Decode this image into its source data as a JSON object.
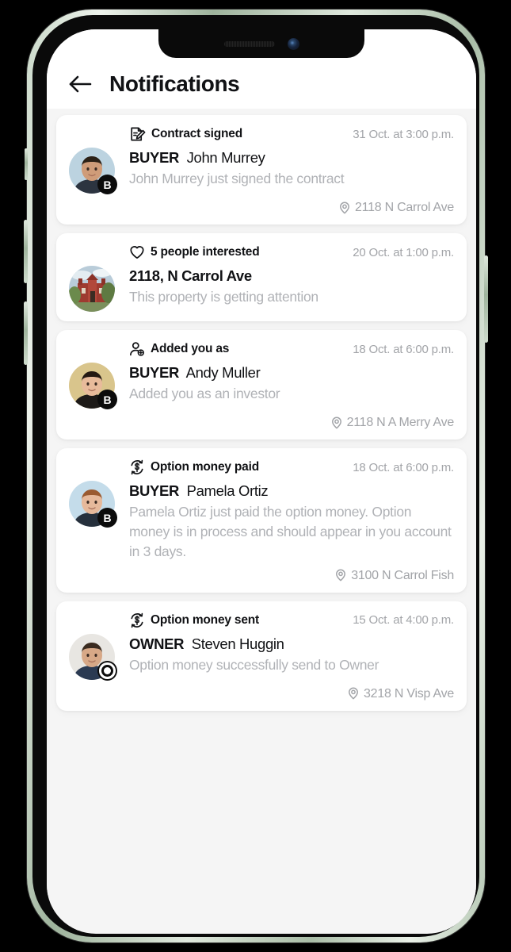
{
  "header": {
    "title": "Notifications",
    "back_icon": "arrow-left-icon"
  },
  "device": {
    "notch_speaker": "speaker-grille",
    "notch_camera": "front-camera"
  },
  "notifications": [
    {
      "type_icon": "contract-signed-icon",
      "type_label": "Contract signed",
      "time": "31 Oct. at 3:00 p.m.",
      "avatar": "man-outdoors-photo",
      "badge": "B",
      "badge_role": "buyer",
      "role_label": "BUYER",
      "person_name": "John Murrey",
      "message": "John Murrey just signed the contract",
      "location_icon": "map-pin-icon",
      "location": "2118 N Carrol Ave",
      "has_location": true
    },
    {
      "type_icon": "heart-icon",
      "type_label": "5 people interested",
      "time": "20 Oct. at 1:00 p.m.",
      "avatar": "red-brick-mansion-photo",
      "badge": "",
      "badge_role": "none",
      "role_label": "",
      "person_name": "2118, N Carrol Ave",
      "message": "This property is getting attention",
      "location_icon": "map-pin-icon",
      "location": "",
      "has_location": false
    },
    {
      "type_icon": "person-add-icon",
      "type_label": "Added you as",
      "time": "18 Oct. at 6:00 p.m.",
      "avatar": "woman-dark-hair-photo",
      "badge": "B",
      "badge_role": "buyer",
      "role_label": "BUYER",
      "person_name": "Andy Muller",
      "message": "Added you as an investor",
      "location_icon": "map-pin-icon",
      "location": "2118 N A Merry Ave",
      "has_location": true
    },
    {
      "type_icon": "money-transfer-icon",
      "type_label": "Option money paid",
      "time": "18 Oct. at 6:00 p.m.",
      "avatar": "woman-red-hair-photo",
      "badge": "B",
      "badge_role": "buyer",
      "role_label": "BUYER",
      "person_name": "Pamela Ortiz",
      "message": "Pamela Ortiz just paid the option money. Option money is in process and should appear in you account in 3 days.",
      "location_icon": "map-pin-icon",
      "location": "3100 N Carrol Fish",
      "has_location": true
    },
    {
      "type_icon": "money-transfer-icon",
      "type_label": "Option money sent",
      "time": "15 Oct. at 4:00 p.m.",
      "avatar": "man-indoors-photo",
      "badge": "O",
      "badge_role": "owner",
      "role_label": "OWNER",
      "person_name": "Steven Huggin",
      "message": "Option money successfully send to Owner",
      "location_icon": "map-pin-icon",
      "location": "3218 N Visp Ave",
      "has_location": true
    }
  ],
  "colors": {
    "screen_bg": "#f5f5f5",
    "card_bg": "#ffffff",
    "primary_text": "#111215",
    "muted_text": "#b0b2b6",
    "meta_text": "#a2a4a8",
    "badge_bg": "#0c0c0c",
    "frame": "#b6c8b4"
  }
}
